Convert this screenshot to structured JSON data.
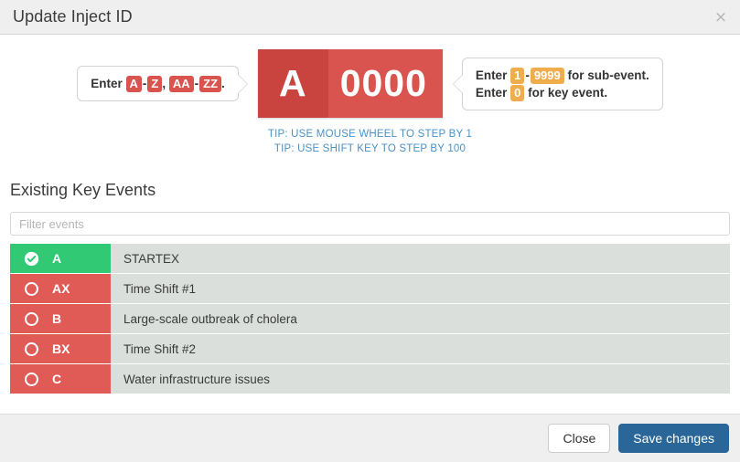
{
  "header": {
    "title": "Update Inject ID",
    "close_icon": "close-icon",
    "close_label": "×"
  },
  "id_editor": {
    "hint_left": {
      "prefix": "Enter",
      "badges": [
        "A",
        "Z",
        "AA",
        "ZZ"
      ],
      "separator_dash": "-",
      "comma": ",",
      "period": ".",
      "badge_color": "#d9534f"
    },
    "hint_right": {
      "line1_prefix": "Enter",
      "line1_badge_from": "1",
      "line1_dash": "-",
      "line1_badge_to": "9999",
      "line1_suffix": "for sub-event.",
      "line2_prefix": "Enter",
      "line2_badge": "0",
      "line2_suffix": "for key event.",
      "badge_color": "#f0ad4e"
    },
    "letter_value": "A",
    "number_value": "0000",
    "letter_bg": "#c9443f",
    "number_bg": "#d9534f",
    "tips": [
      "TIP: USE MOUSE WHEEL TO STEP BY 1",
      "TIP: USE SHIFT KEY TO STEP BY 100"
    ],
    "tips_color": "#4a92c4"
  },
  "events_section": {
    "title": "Existing Key Events",
    "filter_placeholder": "Filter events",
    "filter_value": "",
    "selected_color": "#31c974",
    "unselected_color": "#e05a56",
    "desc_bg": "#dbdfdb",
    "rows": [
      {
        "key": "A",
        "description": "STARTEX",
        "selected": true,
        "icon": "check-circle-icon"
      },
      {
        "key": "AX",
        "description": "Time Shift #1",
        "selected": false,
        "icon": "circle-icon"
      },
      {
        "key": "B",
        "description": "Large-scale outbreak of cholera",
        "selected": false,
        "icon": "circle-icon"
      },
      {
        "key": "BX",
        "description": "Time Shift #2",
        "selected": false,
        "icon": "circle-icon"
      },
      {
        "key": "C",
        "description": "Water infrastructure issues",
        "selected": false,
        "icon": "circle-icon"
      }
    ]
  },
  "footer": {
    "close_label": "Close",
    "save_label": "Save changes",
    "primary_color": "#2b6699"
  }
}
